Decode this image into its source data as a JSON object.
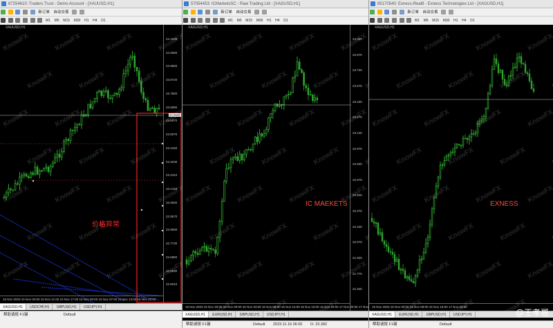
{
  "windows": [
    {
      "title": "67254610: Traders Trust - Demo Account - [XAUUSD,H1]",
      "symbol_label": "XAUUSD,H1",
      "new_order_label": "新订单",
      "auto_trading_label": "自动交易",
      "annotation": "价格异常",
      "price_labels": [
        "24.1505",
        "24.0560",
        "23.9660",
        "23.8720",
        "23.7800",
        "23.6890",
        "23.5970",
        "23.5070",
        "23.4150",
        "23.3230",
        "23.2310",
        "23.1410",
        "23.0500",
        "22.9570",
        "22.8660",
        "22.7730",
        "22.6850",
        "22.5930",
        "22.5010"
      ],
      "current_price": "23.6530",
      "time_labels": "15 Nov 2023  15 Nov 04:00  15 Nov 11:00  15 Nov 17:00  16 Nov 00:00  16 Nov 07:00  16 Nov 13:00  16 Nov 20:00",
      "tabs": [
        "XAGUSD,H1",
        "USDCHF,H1",
        "GBPUSD,H1",
        "USDJPY,H1"
      ],
      "status": [
        "帮助请按 F1键",
        "Default"
      ]
    },
    {
      "title": "57054453: ICMarketsSC - Raw Trading Ltd - [XAGUSD,H1]",
      "symbol_label": "XAGUSD,H1",
      "new_order_label": "新订单",
      "auto_trading_label": "自动交易",
      "broker_label": "IC MAEKETS",
      "price_labels": [
        "24.025",
        "23.875",
        "23.725",
        "23.575",
        "23.425",
        "23.275",
        "23.125",
        "22.975",
        "22.825",
        "22.675",
        "22.525",
        "22.375",
        "22.225",
        "22.075",
        "21.925",
        "21.775",
        "21.625"
      ],
      "time_labels": "15 Nov 2023  15 Nov 20:00  16 Nov 00:00  16 Nov 04:00  16 Nov 08:00  16 Nov 12:00  16 Nov 16:00  16 Nov 20:00  17 Nov 00:00  17 Nov 04:00",
      "tabs": [
        "XAGUSD,H1",
        "EURUSD,H1",
        "GBPUSD,H1",
        "USDJPY,H1"
      ],
      "status": [
        "帮助请按 F1键",
        "Default",
        "2023.11.16 06:00",
        "O: 23.382"
      ]
    },
    {
      "title": "85170540: Exness-Real8 - Exness Technologies Ltd - [XAGUSD,H1]",
      "symbol_label": "XAGUSD,H1",
      "new_order_label": "新订单",
      "auto_trading_label": "自动交易",
      "broker_label": "EXNESS",
      "time_labels": "15 Nov 2023  16 Nov 00:00  16 Nov 08:00  16 Nov 16:00  17 Nov 00:00",
      "tabs": [
        "XAGUSD,H1",
        "EURUSD,H1",
        "GBPUSD,H1",
        "USDJPY,H1"
      ],
      "status": [
        "帮助请按 F1键",
        "Default"
      ]
    }
  ],
  "timeframes": [
    "M1",
    "M5",
    "M15",
    "M30",
    "H1",
    "H4",
    "D1",
    "W1",
    "MN"
  ],
  "watermark_text": "KnowFX",
  "credit": "@王孝哥",
  "colors": {
    "bull": "#3ad13a",
    "bear": "#2fa52f",
    "annotation": "#ff2a2a",
    "box": "#e02020",
    "blue_lines": "#1a2fbf",
    "price_line": "#c8c8c8"
  }
}
